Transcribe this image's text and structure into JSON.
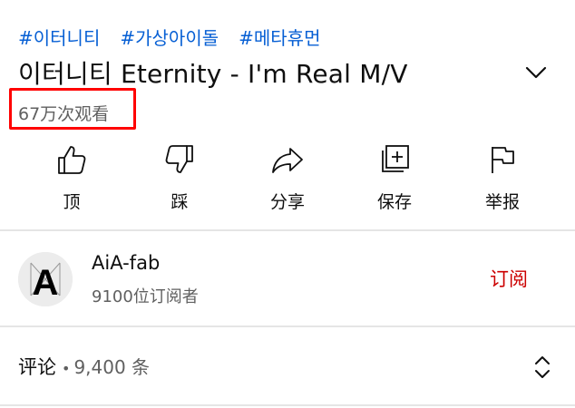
{
  "hashtags": [
    "#이터니티",
    "#가상아이돌",
    "#메타휴먼"
  ],
  "video": {
    "title": "이터니티 Eternity - I'm Real M/V",
    "views": "67万次观看"
  },
  "actions": {
    "like": "顶",
    "dislike": "踩",
    "share": "分享",
    "save": "保存",
    "report": "举报"
  },
  "channel": {
    "name": "AiA-fab",
    "subscribers": "9100位订阅者",
    "subscribe_label": "订阅",
    "avatar_letter": "A"
  },
  "comments": {
    "label": "评论",
    "separator": "•",
    "count": "9,400 条"
  },
  "colors": {
    "link": "#065fd4",
    "subscribe": "#cc0000",
    "highlight_box": "#ff0000"
  },
  "icons": [
    "chevron-down-icon",
    "thumb-up-icon",
    "thumb-down-icon",
    "share-icon",
    "save-playlist-icon",
    "flag-icon",
    "sort-icon"
  ]
}
